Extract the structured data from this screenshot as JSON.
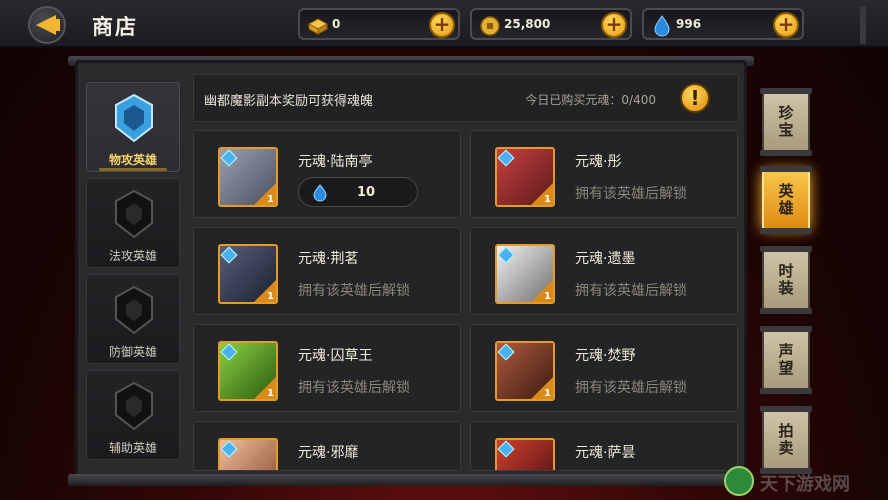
{
  "header": {
    "title": "商店",
    "currencies": [
      {
        "icon": "gold-bar-icon",
        "value": "0"
      },
      {
        "icon": "gold-coin-icon",
        "value": "25,800"
      },
      {
        "icon": "soul-drop-icon",
        "value": "996"
      }
    ]
  },
  "info": {
    "description": "幽都魔影副本奖励可获得魂魄",
    "daily_count": "今日已购买元魂：0/400",
    "warn_glyph": "!"
  },
  "categories": [
    {
      "label": "物攻英雄",
      "active": true
    },
    {
      "label": "法攻英雄",
      "active": false
    },
    {
      "label": "防御英雄",
      "active": false
    },
    {
      "label": "辅助英雄",
      "active": false
    }
  ],
  "items": [
    {
      "title": "元魂·陆南亭",
      "price": "10",
      "level": "1",
      "color": "#6a7080"
    },
    {
      "title": "元魂·彤",
      "status": "拥有该英雄后解锁",
      "level": "1",
      "color": "#8a2a2a"
    },
    {
      "title": "元魂·荆茗",
      "status": "拥有该英雄后解锁",
      "level": "1",
      "color": "#3a3f5a"
    },
    {
      "title": "元魂·遗墨",
      "status": "拥有该英雄后解锁",
      "level": "1",
      "color": "#c8c8c8"
    },
    {
      "title": "元魂·囚草王",
      "status": "拥有该英雄后解锁",
      "level": "1",
      "color": "#4a8a2a"
    },
    {
      "title": "元魂·焚野",
      "status": "拥有该英雄后解锁",
      "level": "1",
      "color": "#7a3a2a"
    },
    {
      "title": "元魂·邪靡",
      "status": "",
      "level": "",
      "color": "#c89a7a"
    },
    {
      "title": "元魂·萨昙",
      "status": "",
      "level": "",
      "color": "#8a2a1a"
    }
  ],
  "tabs": [
    {
      "label": "珍宝",
      "active": false
    },
    {
      "label": "英雄",
      "active": true
    },
    {
      "label": "时装",
      "active": false
    },
    {
      "label": "声望",
      "active": false
    },
    {
      "label": "拍卖",
      "active": false
    }
  ],
  "watermark": "天下游戏网"
}
